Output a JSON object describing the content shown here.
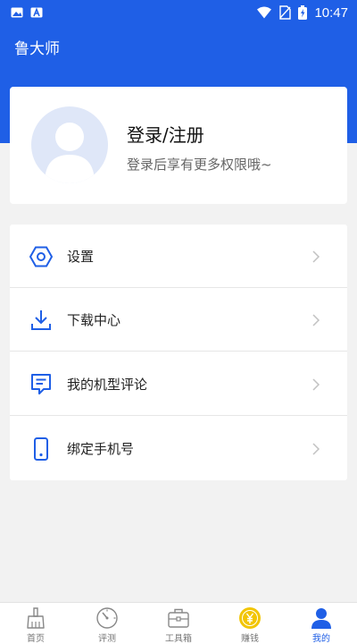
{
  "status_bar": {
    "time": "10:47"
  },
  "header": {
    "title": "鲁大师"
  },
  "profile": {
    "login_title": "登录/注册",
    "login_subtitle": "登录后享有更多权限哦~"
  },
  "menu": {
    "items": [
      {
        "label": "设置",
        "icon": "settings-hexagon-icon"
      },
      {
        "label": "下载中心",
        "icon": "download-icon"
      },
      {
        "label": "我的机型评论",
        "icon": "comment-icon"
      },
      {
        "label": "绑定手机号",
        "icon": "phone-icon"
      }
    ]
  },
  "bottom_nav": {
    "items": [
      {
        "label": "首页",
        "icon": "broom-icon",
        "active": false
      },
      {
        "label": "评测",
        "icon": "gauge-icon",
        "active": false
      },
      {
        "label": "工具箱",
        "icon": "toolbox-icon",
        "active": false
      },
      {
        "label": "赚钱",
        "icon": "coin-icon",
        "active": false
      },
      {
        "label": "我的",
        "icon": "user-icon",
        "active": true
      }
    ]
  },
  "colors": {
    "accent": "#1f5fe6",
    "coin": "#f2c500",
    "background": "#f2f2f2"
  }
}
